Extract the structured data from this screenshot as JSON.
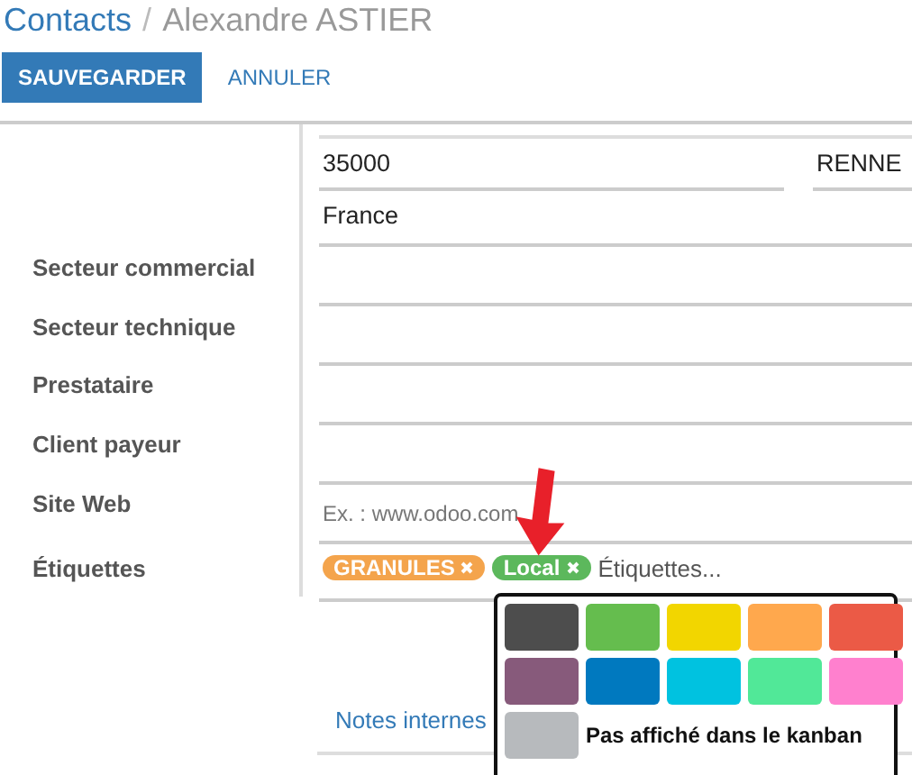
{
  "breadcrumb": {
    "parent": "Contacts",
    "separator": "/",
    "current": "Alexandre ASTIER"
  },
  "buttons": {
    "save": "SAUVEGARDER",
    "cancel": "ANNULER"
  },
  "address": {
    "zip": "35000",
    "city": "RENNE",
    "country": "France"
  },
  "fields": [
    {
      "label": "Secteur commercial"
    },
    {
      "label": "Secteur technique"
    },
    {
      "label": "Prestataire"
    },
    {
      "label": "Client payeur"
    },
    {
      "label": "Site Web",
      "placeholder": "Ex. : www.odoo.com"
    }
  ],
  "tags_field": {
    "label": "Étiquettes",
    "placeholder": "Étiquettes...",
    "tags": [
      {
        "label": "GRANULES",
        "color": "#f4a44c"
      },
      {
        "label": "Local",
        "color": "#5cb85c"
      }
    ]
  },
  "tab": {
    "label": "Notes internes"
  },
  "color_picker": {
    "colors": [
      {
        "color": "#4d4d4d"
      },
      {
        "color": "#65bd4e"
      },
      {
        "color": "#f2d600"
      },
      {
        "color": "#ffa84d"
      },
      {
        "color": "#eb5a46"
      },
      {
        "color": "#875a7b"
      },
      {
        "color": "#0079bf"
      },
      {
        "color": "#00c2e0"
      },
      {
        "color": "#51e898"
      },
      {
        "color": "#ff80ce"
      }
    ],
    "hidden_option": {
      "color": "#b7babd",
      "label": "Pas affiché dans le kanban"
    }
  }
}
